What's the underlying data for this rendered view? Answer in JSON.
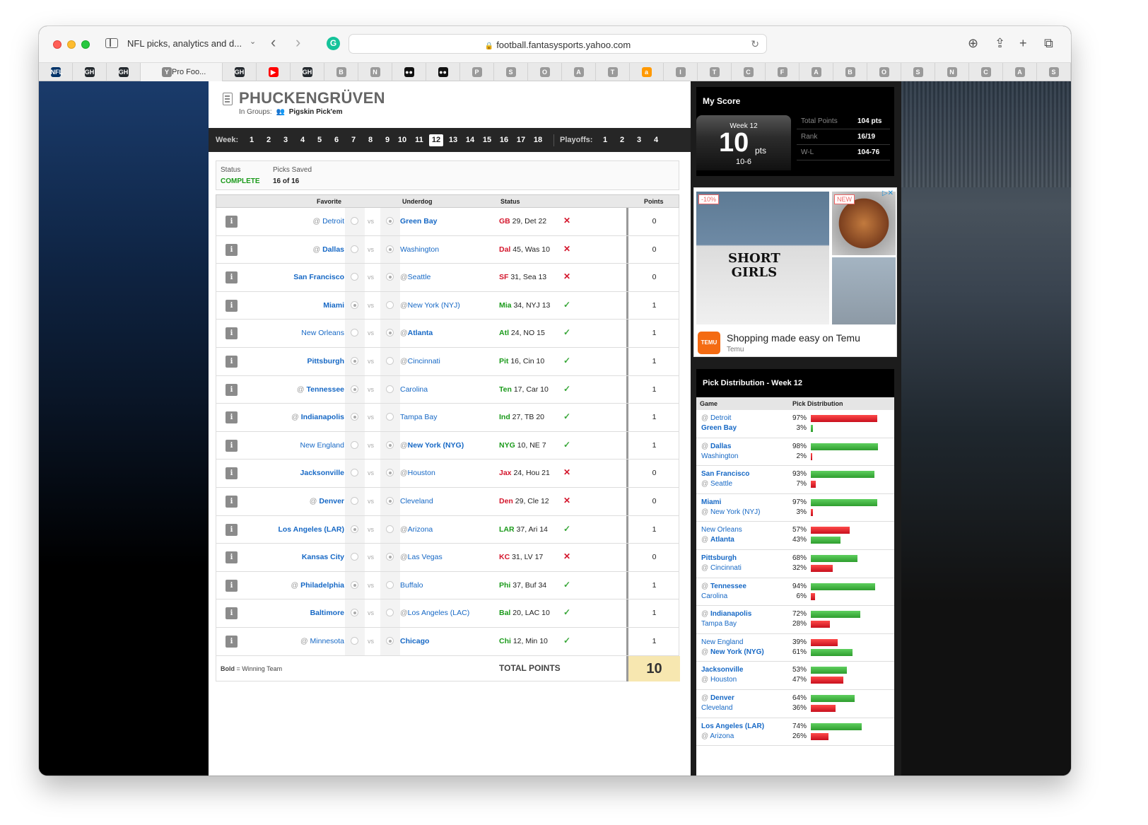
{
  "browser": {
    "tab_title": "NFL picks, analytics and d...",
    "url": "football.fantasysports.yahoo.com",
    "favtabs": [
      {
        "glyph": "NFL",
        "color": "#013369"
      },
      {
        "glyph": "GH",
        "color": "#24292e"
      },
      {
        "glyph": "GH",
        "color": "#24292e"
      },
      {
        "glyph": "Y",
        "color": "#888888",
        "label": "Pro Foo..."
      },
      {
        "glyph": "GH",
        "color": "#24292e"
      },
      {
        "glyph": "▶",
        "color": "#ff0000"
      },
      {
        "glyph": "GH",
        "color": "#24292e"
      },
      {
        "glyph": "B",
        "color": "#9a9a9a"
      },
      {
        "glyph": "N",
        "color": "#9a9a9a"
      },
      {
        "glyph": "●●",
        "color": "#111111"
      },
      {
        "glyph": "●●",
        "color": "#111111"
      },
      {
        "glyph": "P",
        "color": "#9a9a9a"
      },
      {
        "glyph": "S",
        "color": "#9a9a9a"
      },
      {
        "glyph": "O",
        "color": "#9a9a9a"
      },
      {
        "glyph": "A",
        "color": "#9a9a9a"
      },
      {
        "glyph": "T",
        "color": "#9a9a9a"
      },
      {
        "glyph": "a",
        "color": "#ff9900"
      },
      {
        "glyph": "I",
        "color": "#9a9a9a"
      },
      {
        "glyph": "T",
        "color": "#9a9a9a"
      },
      {
        "glyph": "C",
        "color": "#9a9a9a"
      },
      {
        "glyph": "F",
        "color": "#9a9a9a"
      },
      {
        "glyph": "A",
        "color": "#9a9a9a"
      },
      {
        "glyph": "B",
        "color": "#9a9a9a"
      },
      {
        "glyph": "O",
        "color": "#9a9a9a"
      },
      {
        "glyph": "S",
        "color": "#9a9a9a"
      },
      {
        "glyph": "N",
        "color": "#9a9a9a"
      },
      {
        "glyph": "C",
        "color": "#9a9a9a"
      },
      {
        "glyph": "A",
        "color": "#9a9a9a"
      },
      {
        "glyph": "S",
        "color": "#9a9a9a"
      }
    ]
  },
  "header": {
    "team_name": "PHUCKENGRÜVEN",
    "in_groups_label": "In Groups:",
    "group_name": "Pigskin Pick'em"
  },
  "weeks": {
    "label": "Week:",
    "items": [
      "1",
      "2",
      "3",
      "4",
      "5",
      "6",
      "7",
      "8",
      "9",
      "10",
      "11",
      "12",
      "13",
      "14",
      "15",
      "16",
      "17",
      "18"
    ],
    "current": "12",
    "playoffs_label": "Playoffs:",
    "playoffs": [
      "1",
      "2",
      "3",
      "4"
    ]
  },
  "status": {
    "status_label": "Status",
    "status_value": "COMPLETE",
    "saved_label": "Picks Saved",
    "saved_value": "16 of 16"
  },
  "table": {
    "headers": {
      "favorite": "Favorite",
      "underdog": "Underdog",
      "status": "Status",
      "points": "Points"
    },
    "vs": "vs",
    "rows": [
      {
        "fav_at": "@",
        "fav": "Detroit",
        "fav_win": false,
        "dog_at": "",
        "dog": "Green Bay",
        "dog_win": true,
        "pick": "dog",
        "win_abbr": "GB",
        "score_rest": "29, Det 22",
        "win_color": "red",
        "result": "✕",
        "points": "0"
      },
      {
        "fav_at": "@",
        "fav": "Dallas",
        "fav_win": true,
        "dog_at": "",
        "dog": "Washington",
        "dog_win": false,
        "pick": "dog",
        "win_abbr": "Dal",
        "score_rest": "45, Was 10",
        "win_color": "red",
        "result": "✕",
        "points": "0"
      },
      {
        "fav_at": "",
        "fav": "San Francisco",
        "fav_win": true,
        "dog_at": "@",
        "dog": "Seattle",
        "dog_win": false,
        "pick": "dog",
        "win_abbr": "SF",
        "score_rest": "31, Sea 13",
        "win_color": "red",
        "result": "✕",
        "points": "0"
      },
      {
        "fav_at": "",
        "fav": "Miami",
        "fav_win": true,
        "dog_at": "@",
        "dog": "New York (NYJ)",
        "dog_win": false,
        "pick": "fav",
        "win_abbr": "Mia",
        "score_rest": "34, NYJ 13",
        "win_color": "green",
        "result": "✓",
        "points": "1"
      },
      {
        "fav_at": "",
        "fav": "New Orleans",
        "fav_win": false,
        "dog_at": "@",
        "dog": "Atlanta",
        "dog_win": true,
        "pick": "dog",
        "win_abbr": "Atl",
        "score_rest": "24, NO 15",
        "win_color": "green",
        "result": "✓",
        "points": "1"
      },
      {
        "fav_at": "",
        "fav": "Pittsburgh",
        "fav_win": true,
        "dog_at": "@",
        "dog": "Cincinnati",
        "dog_win": false,
        "pick": "fav",
        "win_abbr": "Pit",
        "score_rest": "16, Cin 10",
        "win_color": "green",
        "result": "✓",
        "points": "1"
      },
      {
        "fav_at": "@",
        "fav": "Tennessee",
        "fav_win": true,
        "dog_at": "",
        "dog": "Carolina",
        "dog_win": false,
        "pick": "fav",
        "win_abbr": "Ten",
        "score_rest": "17, Car 10",
        "win_color": "green",
        "result": "✓",
        "points": "1"
      },
      {
        "fav_at": "@",
        "fav": "Indianapolis",
        "fav_win": true,
        "dog_at": "",
        "dog": "Tampa Bay",
        "dog_win": false,
        "pick": "fav",
        "win_abbr": "Ind",
        "score_rest": "27, TB 20",
        "win_color": "green",
        "result": "✓",
        "points": "1"
      },
      {
        "fav_at": "",
        "fav": "New England",
        "fav_win": false,
        "dog_at": "@",
        "dog": "New York (NYG)",
        "dog_win": true,
        "pick": "dog",
        "win_abbr": "NYG",
        "score_rest": "10, NE 7",
        "win_color": "green",
        "result": "✓",
        "points": "1"
      },
      {
        "fav_at": "",
        "fav": "Jacksonville",
        "fav_win": true,
        "dog_at": "@",
        "dog": "Houston",
        "dog_win": false,
        "pick": "dog",
        "win_abbr": "Jax",
        "score_rest": "24, Hou 21",
        "win_color": "red",
        "result": "✕",
        "points": "0"
      },
      {
        "fav_at": "@",
        "fav": "Denver",
        "fav_win": true,
        "dog_at": "",
        "dog": "Cleveland",
        "dog_win": false,
        "pick": "dog",
        "win_abbr": "Den",
        "score_rest": "29, Cle 12",
        "win_color": "red",
        "result": "✕",
        "points": "0"
      },
      {
        "fav_at": "",
        "fav": "Los Angeles (LAR)",
        "fav_win": true,
        "dog_at": "@",
        "dog": "Arizona",
        "dog_win": false,
        "pick": "fav",
        "win_abbr": "LAR",
        "score_rest": "37, Ari 14",
        "win_color": "green",
        "result": "✓",
        "points": "1"
      },
      {
        "fav_at": "",
        "fav": "Kansas City",
        "fav_win": true,
        "dog_at": "@",
        "dog": "Las Vegas",
        "dog_win": false,
        "pick": "dog",
        "win_abbr": "KC",
        "score_rest": "31, LV 17",
        "win_color": "red",
        "result": "✕",
        "points": "0"
      },
      {
        "fav_at": "@",
        "fav": "Philadelphia",
        "fav_win": true,
        "dog_at": "",
        "dog": "Buffalo",
        "dog_win": false,
        "pick": "fav",
        "win_abbr": "Phi",
        "score_rest": "37, Buf 34",
        "win_color": "green",
        "result": "✓",
        "points": "1"
      },
      {
        "fav_at": "",
        "fav": "Baltimore",
        "fav_win": true,
        "dog_at": "@",
        "dog": "Los Angeles (LAC)",
        "dog_win": false,
        "pick": "fav",
        "win_abbr": "Bal",
        "score_rest": "20, LAC 10",
        "win_color": "green",
        "result": "✓",
        "points": "1"
      },
      {
        "fav_at": "@",
        "fav": "Minnesota",
        "fav_win": false,
        "dog_at": "",
        "dog": "Chicago",
        "dog_win": true,
        "pick": "dog",
        "win_abbr": "Chi",
        "score_rest": "12, Min 10",
        "win_color": "green",
        "result": "✓",
        "points": "1"
      }
    ],
    "legend_bold": "Bold",
    "legend_rest": " = Winning Team",
    "total_label": "TOTAL POINTS",
    "total_value": "10"
  },
  "my_score": {
    "title": "My Score",
    "week_label": "Week 12",
    "points_big": "10",
    "pts_unit": "pts",
    "record": "10-6",
    "stats": [
      {
        "label": "Total Points",
        "value": "104 pts"
      },
      {
        "label": "Rank",
        "value": "16/19"
      },
      {
        "label": "W-L",
        "value": "104-76"
      }
    ]
  },
  "ad": {
    "discount": "-10%",
    "new_badge": "NEW",
    "shirt_line1": "SHORT",
    "shirt_line2": "GIRLS",
    "title": "Shopping made easy on Temu",
    "brand": "Temu",
    "logo_text": "TEMU",
    "adchoices": "▷✕"
  },
  "pick_dist": {
    "title": "Pick Distribution - Week 12",
    "col_game": "Game",
    "col_dist": "Pick Distribution",
    "rows": [
      {
        "t1_at": "@",
        "t1": "Detroit",
        "t1_win": false,
        "p1": 97,
        "t2_at": "",
        "t2": "Green Bay",
        "t2_win": true,
        "p2": 3
      },
      {
        "t1_at": "@",
        "t1": "Dallas",
        "t1_win": true,
        "p1": 98,
        "t2_at": "",
        "t2": "Washington",
        "t2_win": false,
        "p2": 2
      },
      {
        "t1_at": "",
        "t1": "San Francisco",
        "t1_win": true,
        "p1": 93,
        "t2_at": "@",
        "t2": "Seattle",
        "t2_win": false,
        "p2": 7
      },
      {
        "t1_at": "",
        "t1": "Miami",
        "t1_win": true,
        "p1": 97,
        "t2_at": "@",
        "t2": "New York (NYJ)",
        "t2_win": false,
        "p2": 3
      },
      {
        "t1_at": "",
        "t1": "New Orleans",
        "t1_win": false,
        "p1": 57,
        "t2_at": "@",
        "t2": "Atlanta",
        "t2_win": true,
        "p2": 43
      },
      {
        "t1_at": "",
        "t1": "Pittsburgh",
        "t1_win": true,
        "p1": 68,
        "t2_at": "@",
        "t2": "Cincinnati",
        "t2_win": false,
        "p2": 32
      },
      {
        "t1_at": "@",
        "t1": "Tennessee",
        "t1_win": true,
        "p1": 94,
        "t2_at": "",
        "t2": "Carolina",
        "t2_win": false,
        "p2": 6
      },
      {
        "t1_at": "@",
        "t1": "Indianapolis",
        "t1_win": true,
        "p1": 72,
        "t2_at": "",
        "t2": "Tampa Bay",
        "t2_win": false,
        "p2": 28
      },
      {
        "t1_at": "",
        "t1": "New England",
        "t1_win": false,
        "p1": 39,
        "t2_at": "@",
        "t2": "New York (NYG)",
        "t2_win": true,
        "p2": 61
      },
      {
        "t1_at": "",
        "t1": "Jacksonville",
        "t1_win": true,
        "p1": 53,
        "t2_at": "@",
        "t2": "Houston",
        "t2_win": false,
        "p2": 47
      },
      {
        "t1_at": "@",
        "t1": "Denver",
        "t1_win": true,
        "p1": 64,
        "t2_at": "",
        "t2": "Cleveland",
        "t2_win": false,
        "p2": 36
      },
      {
        "t1_at": "",
        "t1": "Los Angeles (LAR)",
        "t1_win": true,
        "p1": 74,
        "t2_at": "@",
        "t2": "Arizona",
        "t2_win": false,
        "p2": 26
      }
    ]
  }
}
